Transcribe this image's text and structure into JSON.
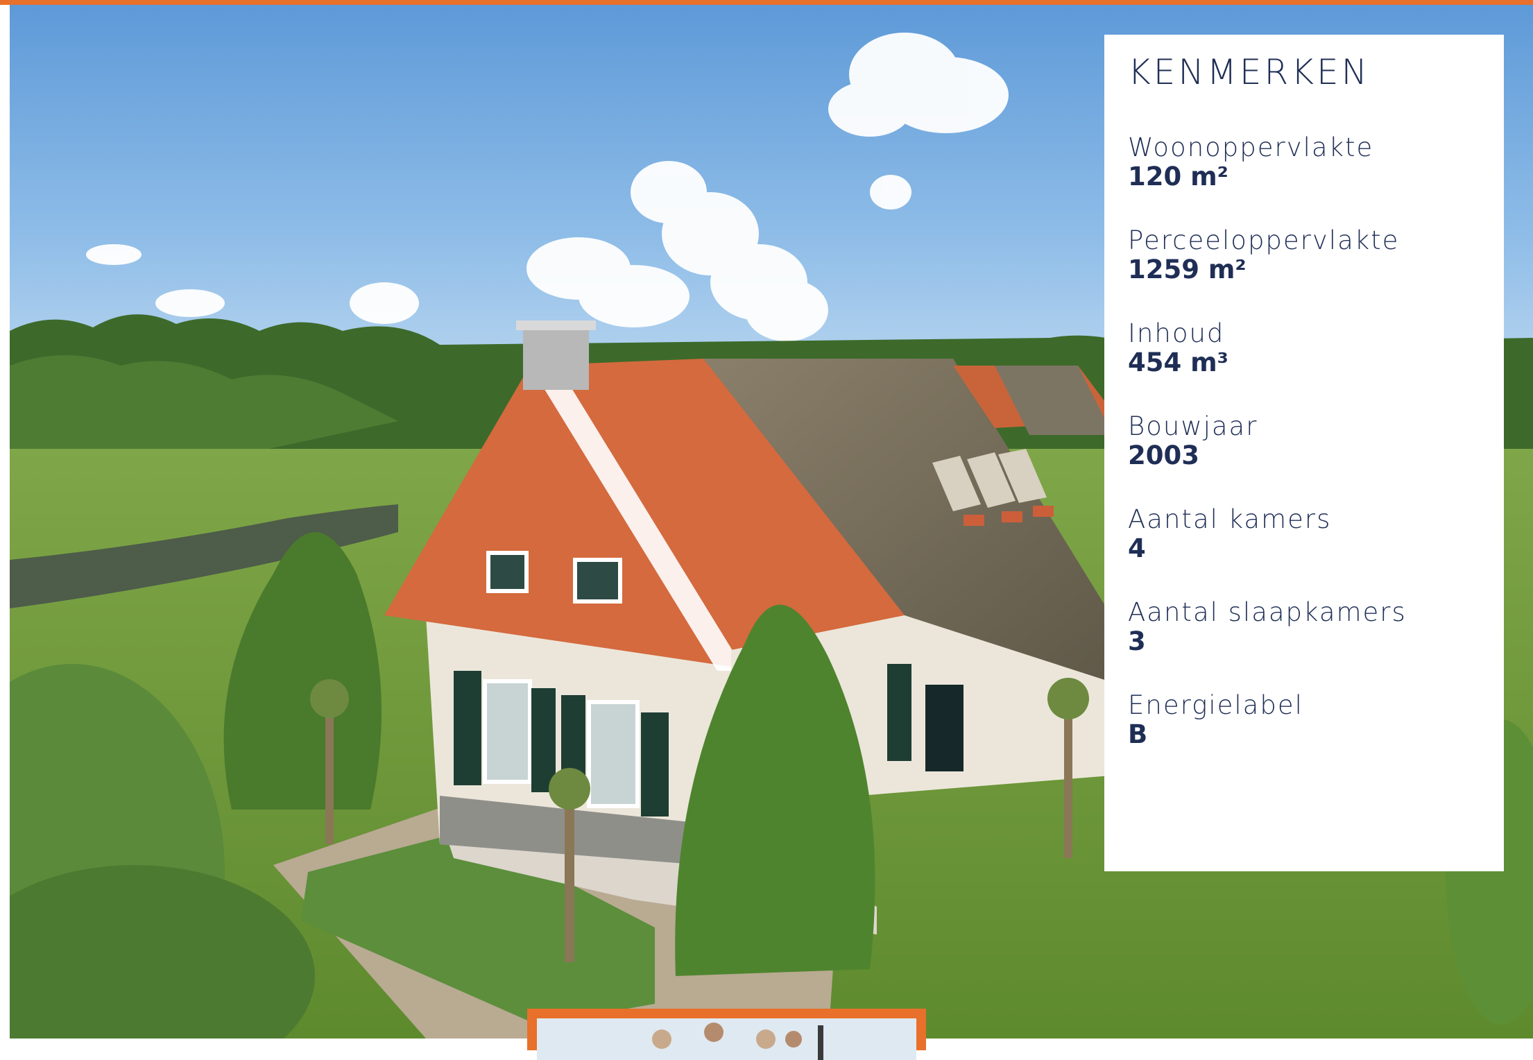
{
  "characteristics": {
    "title": "KENMERKEN",
    "items": [
      {
        "label": "Woonoppervlakte",
        "value": "120 m²"
      },
      {
        "label": "Perceeloppervlakte",
        "value": "1259 m²"
      },
      {
        "label": "Inhoud",
        "value": "454 m³"
      },
      {
        "label": "Bouwjaar",
        "value": "2003"
      },
      {
        "label": "Aantal kamers",
        "value": "4"
      },
      {
        "label": "Aantal slaapkamers",
        "value": "3"
      },
      {
        "label": "Energielabel",
        "value": "B"
      }
    ]
  },
  "colors": {
    "accent": "#e8702a",
    "text": "#1f2e55"
  }
}
